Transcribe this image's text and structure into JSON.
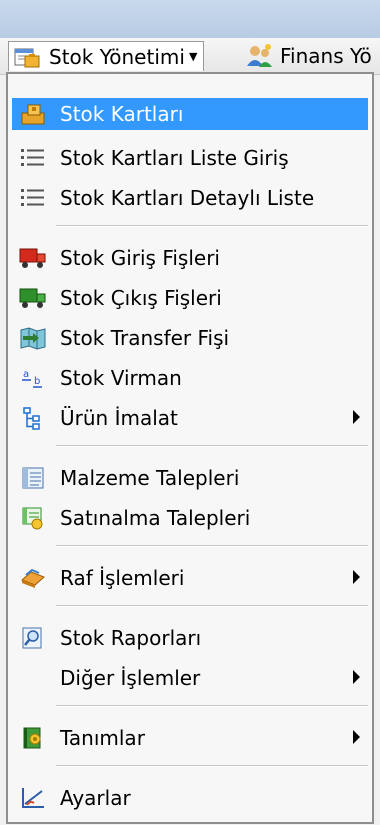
{
  "menubar": {
    "stok_label": "Stok Yönetimi",
    "finans_label": "Finans Yö"
  },
  "menu": {
    "items": [
      {
        "label": "Stok Kartları",
        "icon": "stock-card-icon"
      },
      {
        "label": "Stok Kartları Liste Giriş",
        "icon": "list-icon"
      },
      {
        "label": "Stok Kartları Detaylı Liste",
        "icon": "list-icon"
      },
      {
        "label": "Stok Giriş Fişleri",
        "icon": "truck-in-icon"
      },
      {
        "label": "Stok Çıkış Fişleri",
        "icon": "truck-out-icon"
      },
      {
        "label": "Stok Transfer Fişi",
        "icon": "transfer-map-icon"
      },
      {
        "label": "Stok Virman",
        "icon": "virman-icon"
      },
      {
        "label": "Ürün İmalat",
        "icon": "tree-icon"
      },
      {
        "label": "Malzeme Talepleri",
        "icon": "document-icon"
      },
      {
        "label": "Satınalma Talepleri",
        "icon": "purchase-icon"
      },
      {
        "label": "Raf İşlemleri",
        "icon": "shelf-icon"
      },
      {
        "label": "Stok Raporları",
        "icon": "report-search-icon"
      },
      {
        "label": "Diğer İşlemler",
        "icon": ""
      },
      {
        "label": "Tanımlar",
        "icon": "book-gear-icon"
      },
      {
        "label": "Ayarlar",
        "icon": "settings-chart-icon"
      }
    ]
  },
  "colors": {
    "selection": "#3399ff",
    "menu_background": "#f7f7f7"
  }
}
